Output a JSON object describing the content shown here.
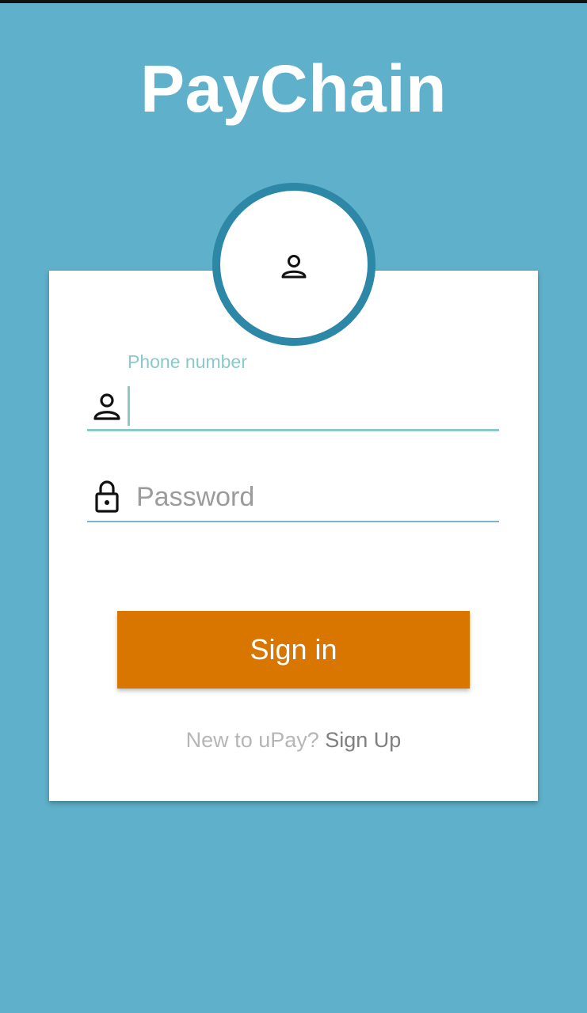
{
  "app": {
    "title": "PayChain"
  },
  "login": {
    "avatar_icon": "person-icon",
    "phone": {
      "label": "Phone number",
      "value": "",
      "icon": "person-icon"
    },
    "password": {
      "placeholder": "Password",
      "value": "",
      "icon": "lock-icon"
    },
    "signin_label": "Sign in",
    "signup_prompt": "New to uPay? ",
    "signup_link": "Sign Up"
  },
  "colors": {
    "background": "#5fb0ca",
    "avatar_ring": "#2d87a6",
    "accent_field": "#8bc9c9",
    "button": "#d97600",
    "card": "#ffffff"
  }
}
